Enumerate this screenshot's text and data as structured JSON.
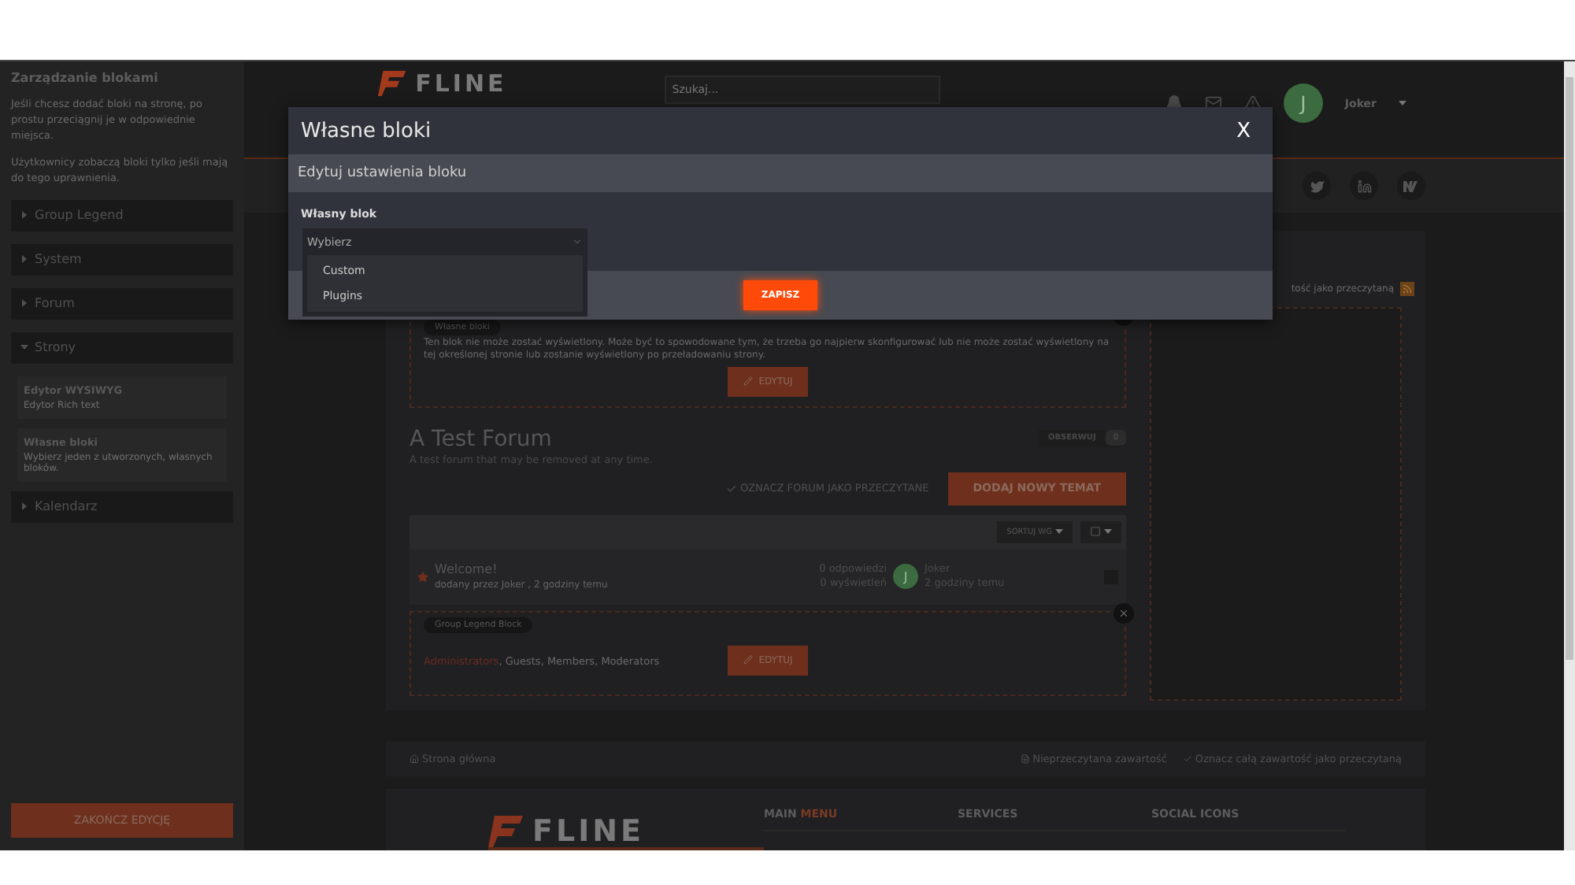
{
  "sidebar": {
    "title": "Zarządzanie blokami",
    "paragraphs": [
      "Jeśli chcesz dodać bloki na stronę, po prostu przeciągnij je w odpowiednie miejsca.",
      "Użytkownicy zobaczą bloki tylko jeśli mają do tego uprawnienia."
    ],
    "sections": [
      {
        "label": "Group Legend",
        "expanded": false
      },
      {
        "label": "System",
        "expanded": false
      },
      {
        "label": "Forum",
        "expanded": false
      },
      {
        "label": "Strony",
        "expanded": true,
        "children": [
          {
            "title": "Edytor WYSIWYG",
            "description": "Edytor Rich text"
          },
          {
            "title": "Własne bloki",
            "description": "Wybierz jeden z utworzonych, własnych bloków."
          }
        ]
      },
      {
        "label": "Kalendarz",
        "expanded": false
      }
    ],
    "finish_button": "ZAKOŃCZ EDYCJĘ"
  },
  "header": {
    "logo": "FLINE",
    "search": {
      "placeholder": "Szukaj..."
    },
    "user": {
      "initial": "J",
      "name": "Joker"
    }
  },
  "right_panel": {
    "mark_read": "tość jako przeczytaną"
  },
  "custom_block": {
    "tag": "Własne bloki",
    "message": "Ten blok nie może zostać wyświetlony. Może być to spowodowane tym, że trzeba go najpierw skonfigurować lub nie może zostać wyświetlony na tej określonej stronie lub zostanie wyświetlony po przeładowaniu strony.",
    "edit_button": "EDYTUJ"
  },
  "forum": {
    "title": "A Test Forum",
    "description": "A test forum that may be removed at any time.",
    "follow_button": "OBSERWUJ",
    "follow_count": "0",
    "mark_read": "OZNACZ FORUM JAKO PRZECZYTANE",
    "new_topic_button": "DODAJ NOWY TEMAT",
    "sort_button": "SORTUJ WG",
    "topics": [
      {
        "title": "Welcome!",
        "meta": "dodany przez Joker , 2 godziny temu",
        "replies": "0 odpowiedzi",
        "views": "0 wyświetleń",
        "avatar": "J",
        "last_user": "Joker",
        "last_time": "2 godziny temu",
        "checked": false
      }
    ]
  },
  "legend_block": {
    "tag": "Group Legend Block",
    "groups": [
      {
        "label": "Administrators",
        "color": "#6e2a22"
      },
      {
        "label": ", Guests, Members, Moderators",
        "color": "#6a6a6a"
      }
    ],
    "edit_button": "EDYTUJ"
  },
  "breadcrumb": {
    "home": "Strona główna",
    "unread": "Nieprzeczytana zawartość",
    "mark_all": "Oznacz całą zawartość jako przeczytaną"
  },
  "footer": {
    "logo": "FLINE",
    "columns": [
      {
        "title": "MAIN **MENU**"
      },
      {
        "title": "SERVICES"
      },
      {
        "title": "SOCIAL ICONS"
      }
    ]
  },
  "modal": {
    "title": "Własne bloki",
    "close": "X",
    "subtitle": "Edytuj ustawienia bloku",
    "field_label": "Własny blok",
    "select_value": "Wybierz",
    "options": [
      "Custom",
      "Plugins"
    ],
    "save_button": "ZAPISZ"
  }
}
